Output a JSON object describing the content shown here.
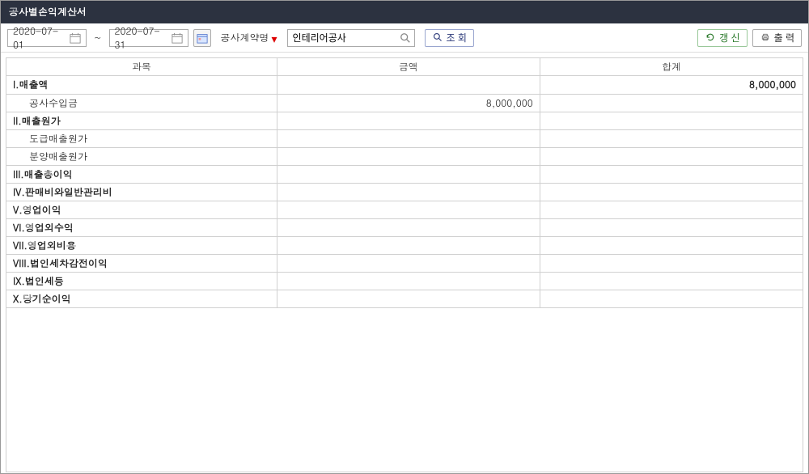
{
  "title": "공사별손익계산서",
  "toolbar": {
    "date_from": "2020-07-01",
    "date_to": "2020-07-31",
    "field_label": "공사계약명",
    "search_value": "인테리어공사",
    "lookup_label": "조 회",
    "refresh_label": "갱 신",
    "print_label": "출 력"
  },
  "table": {
    "headers": [
      "과목",
      "금액",
      "합계"
    ],
    "rows": [
      {
        "label": "I.매출액",
        "amount": "",
        "total": "8,000,000",
        "bold": true,
        "indent": false
      },
      {
        "label": "공사수입금",
        "amount": "8,000,000",
        "total": "",
        "bold": false,
        "indent": true
      },
      {
        "label": "II.매출원가",
        "amount": "",
        "total": "",
        "bold": true,
        "indent": false
      },
      {
        "label": "도급매출원가",
        "amount": "",
        "total": "",
        "bold": false,
        "indent": true
      },
      {
        "label": "분양매출원가",
        "amount": "",
        "total": "",
        "bold": false,
        "indent": true
      },
      {
        "label": "III.매출총이익",
        "amount": "",
        "total": "",
        "bold": true,
        "indent": false
      },
      {
        "label": "IV.판매비와일반관리비",
        "amount": "",
        "total": "",
        "bold": true,
        "indent": false
      },
      {
        "label": "V.영업이익",
        "amount": "",
        "total": "",
        "bold": true,
        "indent": false
      },
      {
        "label": "VI.영업외수익",
        "amount": "",
        "total": "",
        "bold": true,
        "indent": false
      },
      {
        "label": "VII.영업외비용",
        "amount": "",
        "total": "",
        "bold": true,
        "indent": false
      },
      {
        "label": "VIII.법인세차감전이익",
        "amount": "",
        "total": "",
        "bold": true,
        "indent": false
      },
      {
        "label": "IX.법인세등",
        "amount": "",
        "total": "",
        "bold": true,
        "indent": false
      },
      {
        "label": "X.당기순이익",
        "amount": "",
        "total": "",
        "bold": true,
        "indent": false
      }
    ]
  }
}
